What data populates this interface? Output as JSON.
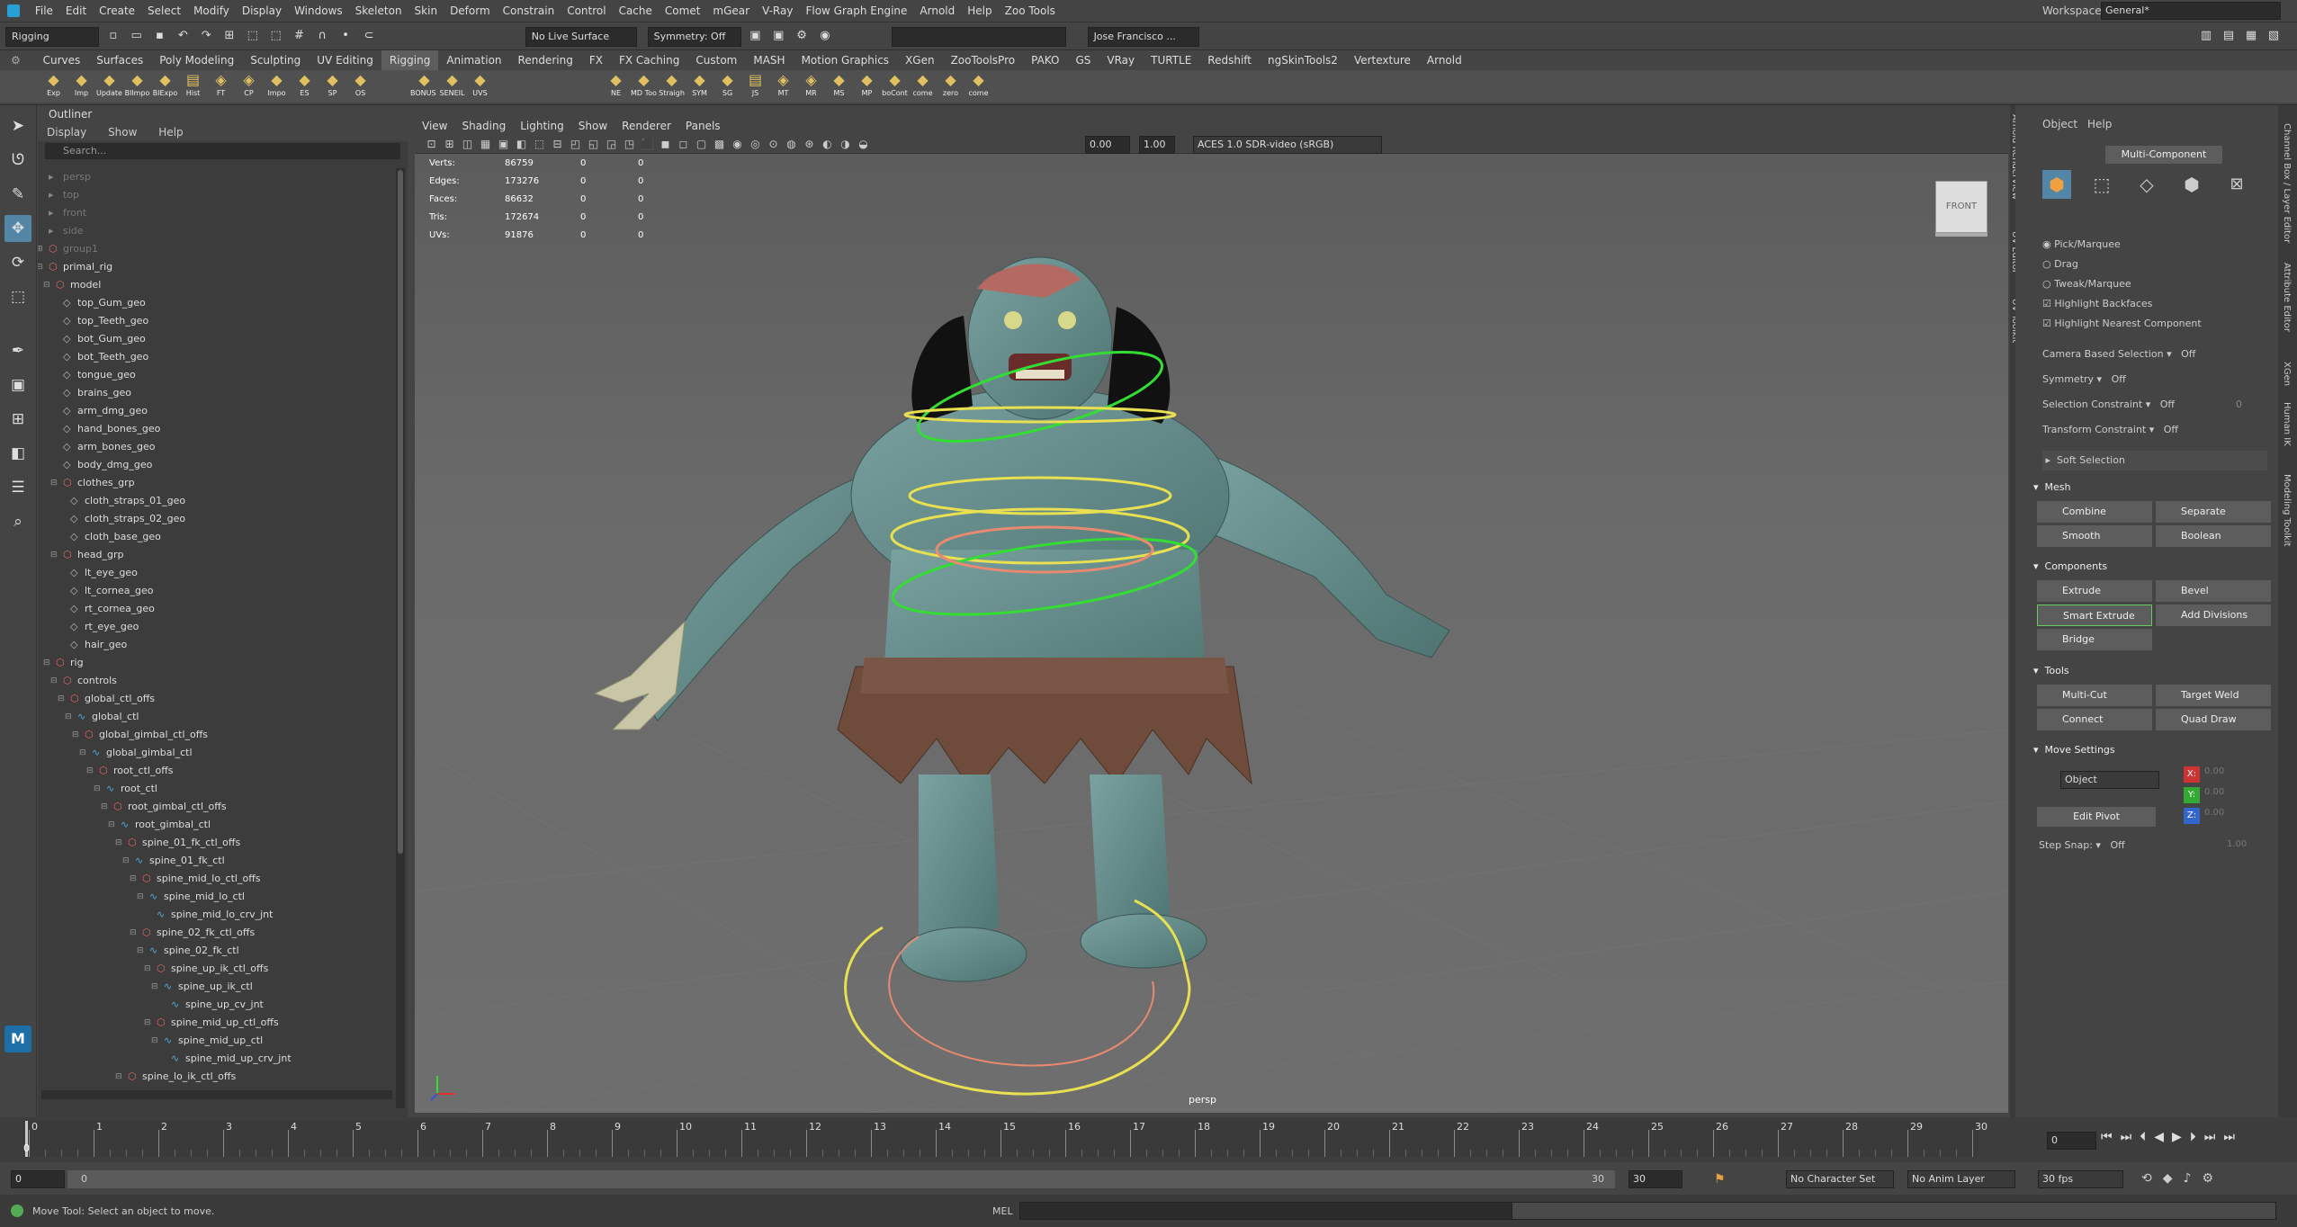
{
  "menubar": {
    "items": [
      "File",
      "Edit",
      "Create",
      "Select",
      "Modify",
      "Display",
      "Windows",
      "Skeleton",
      "Skin",
      "Deform",
      "Constrain",
      "Control",
      "Cache",
      "Comet",
      "mGear",
      "V-Ray",
      "Flow Graph Engine",
      "Arnold",
      "Help",
      "Zoo Tools"
    ],
    "workspace_label": "Workspace:",
    "workspace_value": "General*"
  },
  "statusline": {
    "menuset": "Rigging",
    "live_surface": "No Live Surface",
    "symmetry": "Symmetry: Off",
    "user": "Jose Francisco ..."
  },
  "shelf": {
    "tabs": [
      "Curves",
      "Surfaces",
      "Poly Modeling",
      "Sculpting",
      "UV Editing",
      "Rigging",
      "Animation",
      "Rendering",
      "FX",
      "FX Caching",
      "Custom",
      "MASH",
      "Motion Graphics",
      "XGen",
      "ZooToolsPro",
      "PAKO",
      "GS",
      "VRay",
      "TURTLE",
      "Redshift",
      "ngSkinTools2",
      "Vertexture",
      "Arnold"
    ],
    "icons_a": [
      "Exp",
      "Imp",
      "Update",
      "BlImpo",
      "BlExpo",
      "Hist",
      "FT",
      "CP",
      "Impo",
      "ES",
      "SP",
      "OS"
    ],
    "icons_b": [
      "BONUS TOOL",
      "SENEIL",
      "UVS"
    ],
    "icons_c": [
      "NE",
      "MD Too",
      "Straigh",
      "SYM",
      "SG",
      "JS",
      "MT",
      "MR",
      "MS",
      "MP",
      "boCont",
      "come",
      "zero",
      "come"
    ]
  },
  "outliner": {
    "title": "Outliner",
    "menu": [
      "Display",
      "Show",
      "Help"
    ],
    "search_placeholder": "Search...",
    "rows": [
      {
        "label": "persp",
        "indent": 0,
        "dim": true,
        "icon": "cam"
      },
      {
        "label": "top",
        "indent": 0,
        "dim": true,
        "icon": "cam"
      },
      {
        "label": "front",
        "indent": 0,
        "dim": true,
        "icon": "cam"
      },
      {
        "label": "side",
        "indent": 0,
        "dim": true,
        "icon": "cam"
      },
      {
        "label": "group1",
        "indent": 0,
        "dim": true,
        "icon": "grp",
        "exp": "+"
      },
      {
        "label": "primal_rig",
        "indent": 0,
        "icon": "grp",
        "exp": "-"
      },
      {
        "label": "model",
        "indent": 1,
        "icon": "grp",
        "exp": "-"
      },
      {
        "label": "top_Gum_geo",
        "indent": 2,
        "icon": "mesh"
      },
      {
        "label": "top_Teeth_geo",
        "indent": 2,
        "icon": "mesh"
      },
      {
        "label": "bot_Gum_geo",
        "indent": 2,
        "icon": "mesh"
      },
      {
        "label": "bot_Teeth_geo",
        "indent": 2,
        "icon": "mesh"
      },
      {
        "label": "tongue_geo",
        "indent": 2,
        "icon": "mesh"
      },
      {
        "label": "brains_geo",
        "indent": 2,
        "icon": "mesh"
      },
      {
        "label": "arm_dmg_geo",
        "indent": 2,
        "icon": "mesh"
      },
      {
        "label": "hand_bones_geo",
        "indent": 2,
        "icon": "mesh"
      },
      {
        "label": "arm_bones_geo",
        "indent": 2,
        "icon": "mesh"
      },
      {
        "label": "body_dmg_geo",
        "indent": 2,
        "icon": "mesh"
      },
      {
        "label": "clothes_grp",
        "indent": 2,
        "icon": "grp",
        "exp": "-"
      },
      {
        "label": "cloth_straps_01_geo",
        "indent": 3,
        "icon": "mesh"
      },
      {
        "label": "cloth_straps_02_geo",
        "indent": 3,
        "icon": "mesh"
      },
      {
        "label": "cloth_base_geo",
        "indent": 3,
        "icon": "mesh"
      },
      {
        "label": "head_grp",
        "indent": 2,
        "icon": "grp",
        "exp": "-"
      },
      {
        "label": "lt_eye_geo",
        "indent": 3,
        "icon": "mesh"
      },
      {
        "label": "lt_cornea_geo",
        "indent": 3,
        "icon": "mesh"
      },
      {
        "label": "rt_cornea_geo",
        "indent": 3,
        "icon": "mesh"
      },
      {
        "label": "rt_eye_geo",
        "indent": 3,
        "icon": "mesh"
      },
      {
        "label": "hair_geo",
        "indent": 3,
        "icon": "mesh"
      },
      {
        "label": "rig",
        "indent": 1,
        "icon": "grp",
        "exp": "-"
      },
      {
        "label": "controls",
        "indent": 2,
        "icon": "grp",
        "exp": "-"
      },
      {
        "label": "global_ctl_offs",
        "indent": 3,
        "icon": "grp",
        "exp": "-"
      },
      {
        "label": "global_ctl",
        "indent": 4,
        "icon": "crv",
        "exp": "-"
      },
      {
        "label": "global_gimbal_ctl_offs",
        "indent": 5,
        "icon": "grp",
        "exp": "-"
      },
      {
        "label": "global_gimbal_ctl",
        "indent": 6,
        "icon": "crv",
        "exp": "-"
      },
      {
        "label": "root_ctl_offs",
        "indent": 7,
        "icon": "grp",
        "exp": "-"
      },
      {
        "label": "root_ctl",
        "indent": 8,
        "icon": "crv",
        "exp": "-"
      },
      {
        "label": "root_gimbal_ctl_offs",
        "indent": 9,
        "icon": "grp",
        "exp": "-"
      },
      {
        "label": "root_gimbal_ctl",
        "indent": 10,
        "icon": "crv",
        "exp": "-"
      },
      {
        "label": "spine_01_fk_ctl_offs",
        "indent": 11,
        "icon": "grp",
        "exp": "-"
      },
      {
        "label": "spine_01_fk_ctl",
        "indent": 12,
        "icon": "crv",
        "exp": "-"
      },
      {
        "label": "spine_mid_lo_ctl_offs",
        "indent": 13,
        "icon": "grp",
        "exp": "-"
      },
      {
        "label": "spine_mid_lo_ctl",
        "indent": 14,
        "icon": "crv",
        "exp": "-"
      },
      {
        "label": "spine_mid_lo_crv_jnt",
        "indent": 15,
        "icon": "crv"
      },
      {
        "label": "spine_02_fk_ctl_offs",
        "indent": 13,
        "icon": "grp",
        "exp": "-"
      },
      {
        "label": "spine_02_fk_ctl",
        "indent": 14,
        "icon": "crv",
        "exp": "-"
      },
      {
        "label": "spine_up_ik_ctl_offs",
        "indent": 15,
        "icon": "grp",
        "exp": "-"
      },
      {
        "label": "spine_up_ik_ctl",
        "indent": 16,
        "icon": "crv",
        "exp": "-"
      },
      {
        "label": "spine_up_cv_jnt",
        "indent": 17,
        "icon": "crv"
      },
      {
        "label": "spine_mid_up_ctl_offs",
        "indent": 15,
        "icon": "grp",
        "exp": "-"
      },
      {
        "label": "spine_mid_up_ctl",
        "indent": 16,
        "icon": "crv",
        "exp": "-"
      },
      {
        "label": "spine_mid_up_crv_jnt",
        "indent": 17,
        "icon": "crv"
      },
      {
        "label": "spine_lo_ik_ctl_offs",
        "indent": 11,
        "icon": "grp",
        "exp": "-"
      }
    ]
  },
  "viewport": {
    "menu": [
      "View",
      "Shading",
      "Lighting",
      "Show",
      "Renderer",
      "Panels"
    ],
    "exposure": "0.00",
    "gamma": "1.00",
    "colorspace": "ACES 1.0 SDR-video (sRGB)",
    "camera_label": "persp",
    "viewcube_label": "FRONT",
    "hud": [
      {
        "k": "Verts:",
        "v": "86759",
        "a": "0",
        "b": "0"
      },
      {
        "k": "Edges:",
        "v": "173276",
        "a": "0",
        "b": "0"
      },
      {
        "k": "Faces:",
        "v": "86632",
        "a": "0",
        "b": "0"
      },
      {
        "k": "Tris:",
        "v": "172674",
        "a": "0",
        "b": "0"
      },
      {
        "k": "UVs:",
        "v": "91876",
        "a": "0",
        "b": "0"
      }
    ]
  },
  "modeling_toolkit": {
    "tabs": [
      "Object",
      "Help"
    ],
    "mode_button": "Multi-Component",
    "radios": [
      "Pick/Marquee",
      "Drag",
      "Tweak/Marquee"
    ],
    "checks": [
      "Highlight Backfaces",
      "Highlight Nearest Component"
    ],
    "camera_based": {
      "label": "Camera Based Selection",
      "value": "Off"
    },
    "symmetry": {
      "label": "Symmetry",
      "value": "Off"
    },
    "selection_constraint": {
      "label": "Selection Constraint",
      "value": "Off",
      "num": "0"
    },
    "transform_constraint": {
      "label": "Transform Constraint",
      "value": "Off"
    },
    "soft_selection": "Soft Selection",
    "mesh_title": "Mesh",
    "mesh_buttons": [
      "Combine",
      "Separate",
      "Smooth",
      "Boolean"
    ],
    "components_title": "Components",
    "components_buttons": [
      "Extrude",
      "Bevel",
      "Smart Extrude",
      "Add Divisions",
      "Bridge"
    ],
    "tools_title": "Tools",
    "tools_buttons": [
      "Multi-Cut",
      "Target Weld",
      "Connect",
      "Quad Draw"
    ],
    "move_settings_title": "Move Settings",
    "move_space": "Object",
    "edit_pivot": "Edit Pivot",
    "xyz_labels": [
      "X:",
      "Y:",
      "Z:"
    ],
    "xyz_values": [
      "0.00",
      "0.00",
      "0.00"
    ],
    "step_snap": {
      "label": "Step Snap:",
      "value": "Off",
      "num": "1.00"
    },
    "left_tabs": [
      "Arnold RenderView",
      "UV Editor",
      "UV Toolkit"
    ],
    "right_tabs": [
      "Channel Box / Layer Editor",
      "Attribute Editor",
      "XGen",
      "Human IK",
      "Modeling Toolkit"
    ]
  },
  "timeline": {
    "ticks": [
      "0",
      "1",
      "2",
      "3",
      "4",
      "5",
      "6",
      "7",
      "8",
      "9",
      "10",
      "11",
      "12",
      "13",
      "14",
      "15",
      "16",
      "17",
      "18",
      "19",
      "20",
      "21",
      "22",
      "23",
      "24",
      "25",
      "26",
      "27",
      "28",
      "29",
      "30"
    ],
    "current_frame": "0",
    "frame_field": "0"
  },
  "range": {
    "start": "0",
    "start2": "0",
    "end_inner": "30",
    "end": "30",
    "character_set": "No Character Set",
    "anim_layer": "No Anim Layer",
    "fps": "30 fps"
  },
  "cmdline": {
    "help": "Move Tool: Select an object to move.",
    "mel_label": "MEL"
  }
}
